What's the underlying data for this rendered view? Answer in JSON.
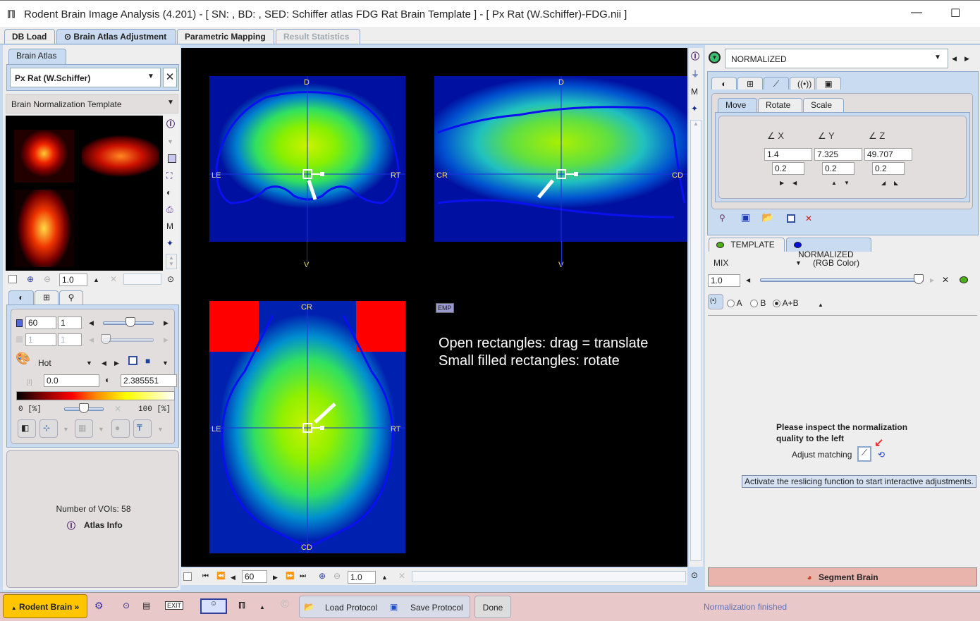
{
  "window": {
    "title": "Rodent Brain Image Analysis (4.201) - [ SN: , BD: , SED: Schiffer atlas FDG Rat Brain Template ] - [ Px Rat (W.Schiffer)-FDG.nii ]",
    "minimize_glyph": "—",
    "maximize_glyph": "☐"
  },
  "main_tabs": [
    {
      "label": "DB Load",
      "state": "normal"
    },
    {
      "label": "Brain Atlas Adjustment",
      "state": "active",
      "prefix": "⊙"
    },
    {
      "label": "Parametric Mapping",
      "state": "normal"
    },
    {
      "label": "Result Statistics",
      "state": "disabled"
    }
  ],
  "left": {
    "atlas_tab": "Brain Atlas",
    "atlas_selected": "Px Rat (W.Schiffer)",
    "template_selected": "Brain Normalization Template",
    "zoom_value": "1.0",
    "display_tabs": [
      "contrast",
      "layout",
      "tools"
    ],
    "slice_value": "60",
    "slice_step": "1",
    "frame_value": "1",
    "frame_step": "1",
    "slice_slider_fraction": 0.55,
    "colormap": "Hot",
    "min_value": "0.0",
    "max_value": "2.385551",
    "range_min_label": "0 [%]",
    "range_max_label": "100 [%]",
    "range_slider_fraction": 0.5,
    "voi_count": "Number of VOIs: 58",
    "atlas_info": "Atlas Info"
  },
  "viewer": {
    "coronal": {
      "top": "D",
      "bottom": "V",
      "left": "LE",
      "right": "RT"
    },
    "sagittal": {
      "top": "D",
      "bottom": "V",
      "left": "CR",
      "right": "CD"
    },
    "axial": {
      "top": "CR",
      "bottom": "CD",
      "left": "LE",
      "right": "RT"
    },
    "emp_label": "EMP",
    "hint_line1": "Open rectangles: drag = translate",
    "hint_line2": "Small filled rectangles: rotate",
    "slice_value": "60",
    "zoom_value": "1.0"
  },
  "right": {
    "series_selected": "NORMALIZED",
    "subtabs": [
      "Move",
      "Rotate",
      "Scale"
    ],
    "active_subtab": "Move",
    "axes": [
      {
        "label": "X",
        "value": "1.4",
        "step": "0.2"
      },
      {
        "label": "Y",
        "value": "7.325",
        "step": "0.2"
      },
      {
        "label": "Z",
        "value": "49.707",
        "step": "0.2"
      }
    ],
    "layer_tabs": [
      {
        "label": "TEMPLATE",
        "color": "#4caf1a"
      },
      {
        "label": "NORMALIZED",
        "color": "#0010e0"
      }
    ],
    "mix_label": "MIX",
    "mix_mode": "(RGB Color)",
    "mix_value": "1.0",
    "mix_slider_fraction": 1.0,
    "radio_options": [
      "A",
      "B",
      "A+B"
    ],
    "radio_selected": "A+B",
    "inspect_msg_line1": "Please inspect the normalization",
    "inspect_msg_line2": "quality to the left",
    "adjust_label": "Adjust matching",
    "tooltip": "Activate the reslicing function to start interactive adjustments.",
    "segment_button": "Segment Brain"
  },
  "bottom": {
    "rodent_brain_button": "Rodent Brain »",
    "load_protocol": "Load Protocol",
    "save_protocol": "Save Protocol",
    "done": "Done",
    "status": "Normalization finished"
  },
  "colors": {
    "accent": "#c8dbf0",
    "status_bar": "#e8c8c8",
    "segment_button": "#e8b4ac",
    "rodent_button": "#ffc600"
  }
}
